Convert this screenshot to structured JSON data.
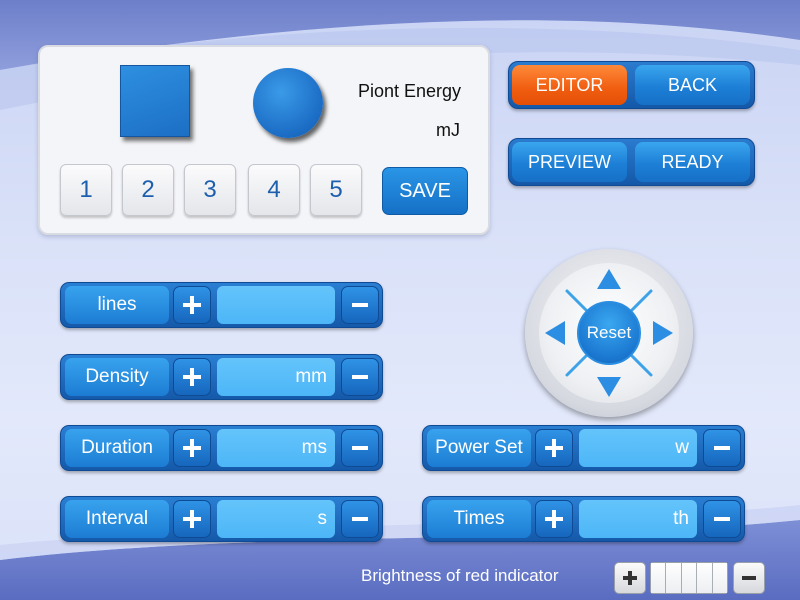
{
  "panel": {
    "energy_label": "Piont Energy",
    "energy_unit": "mJ",
    "numbers": [
      "1",
      "2",
      "3",
      "4",
      "5"
    ],
    "save_label": "SAVE"
  },
  "modes": {
    "editor_label": "EDITOR",
    "back_label": "BACK",
    "preview_label": "PREVIEW",
    "ready_label": "READY",
    "active_color": "#f05d10"
  },
  "params": {
    "lines": {
      "label": "lines",
      "unit": ""
    },
    "density": {
      "label": "Density",
      "unit": "mm"
    },
    "duration": {
      "label": "Duration",
      "unit": "ms"
    },
    "interval": {
      "label": "Interval",
      "unit": "s"
    },
    "power": {
      "label": "Power Set",
      "unit": "w"
    },
    "times": {
      "label": "Times",
      "unit": "th"
    }
  },
  "joystick": {
    "reset_label": "Reset"
  },
  "brightness": {
    "label": "Brightness of red indicator"
  },
  "icons": {
    "plus": "plus-icon",
    "minus": "minus-icon",
    "arrows": [
      "arrow-up-icon",
      "arrow-down-icon",
      "arrow-left-icon",
      "arrow-right-icon"
    ]
  }
}
